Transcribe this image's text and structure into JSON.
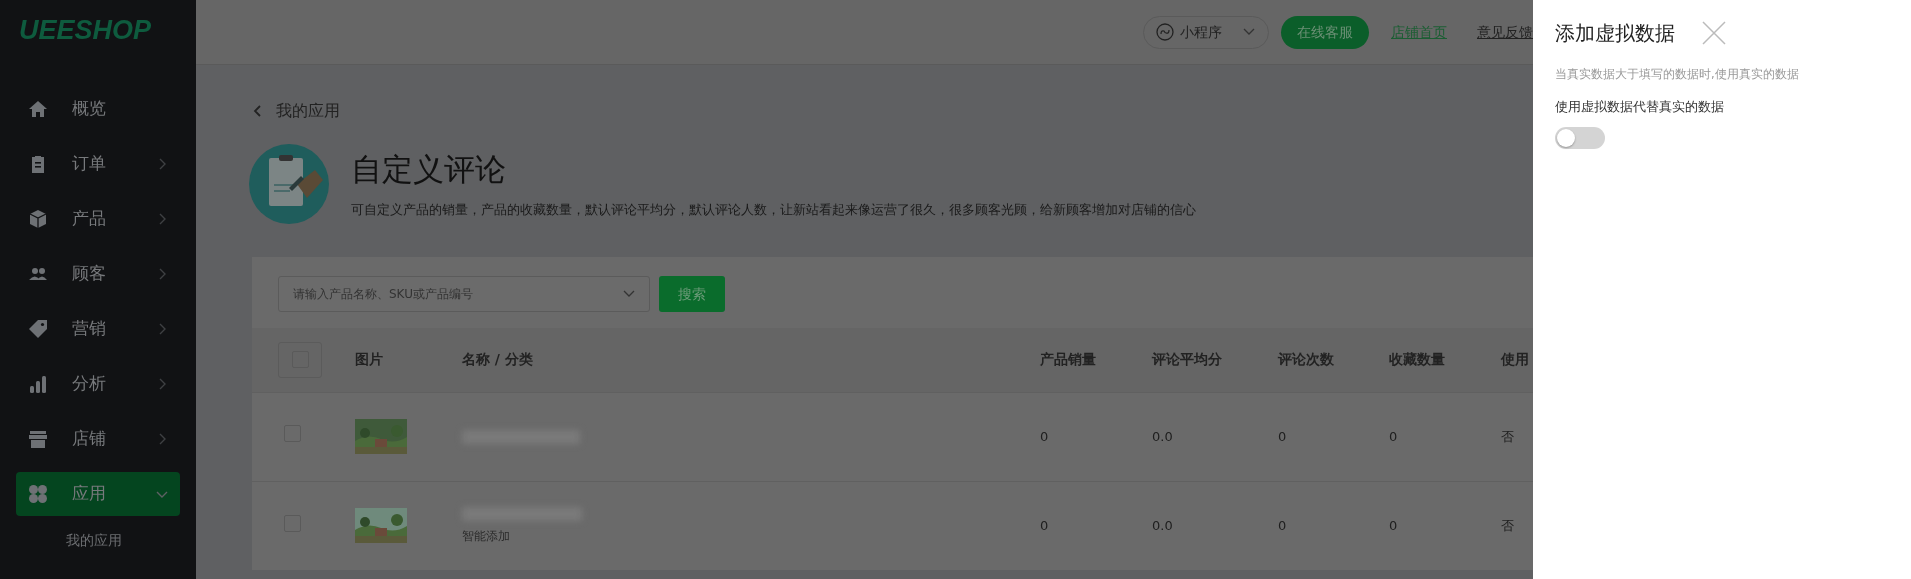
{
  "sidebar": {
    "logo": "UEESHOP",
    "items": [
      {
        "label": "概览",
        "kind": "home",
        "selected": false
      },
      {
        "label": "订单",
        "kind": "order",
        "expanded": false,
        "selected": false
      },
      {
        "label": "产品",
        "kind": "product",
        "expanded": false,
        "selected": false
      },
      {
        "label": "顾客",
        "kind": "customer",
        "expanded": false,
        "selected": false
      },
      {
        "label": "营销",
        "kind": "marketing",
        "expanded": false,
        "selected": false
      },
      {
        "label": "分析",
        "kind": "analytics",
        "expanded": false,
        "selected": false
      },
      {
        "label": "店铺",
        "kind": "store",
        "expanded": false,
        "selected": false
      },
      {
        "label": "应用",
        "kind": "apps",
        "expanded": true,
        "selected": true,
        "children": [
          {
            "label": "我的应用"
          }
        ]
      }
    ]
  },
  "top_bar": {
    "mini_program": {
      "label": "小程序"
    },
    "links": [
      {
        "label": "在线客服",
        "kind": "primary"
      },
      {
        "label": "店铺首页",
        "kind": "green-link"
      },
      {
        "label": "意见反馈",
        "kind": "link"
      }
    ]
  },
  "page": {
    "back_link": "我的应用",
    "title": "自定义评论",
    "description": "可自定义产品的销量，产品的收藏数量，默认评论平均分，默认评论人数，让新站看起来像运营了很久，很多顾客光顾，给新顾客增加对店铺的信心"
  },
  "search": {
    "placeholder": "请输入产品名称、SKU或产品编号",
    "button": "搜索"
  },
  "table": {
    "select_all_checked": false,
    "columns": [
      "图片",
      "名称 / 分类",
      "产品销量",
      "评论平均分",
      "评论次数",
      "收藏数量",
      "使用"
    ],
    "rows": [
      {
        "checked": false,
        "sales": "0",
        "rating": "0.0",
        "reviews": "0",
        "favorites": "0",
        "used": "否"
      },
      {
        "checked": false,
        "tag": "智能添加",
        "sales": "0",
        "rating": "0.0",
        "reviews": "0",
        "favorites": "0",
        "used": "否"
      }
    ]
  },
  "drawer": {
    "title": "添加虚拟数据",
    "hint": "当真实数据大于填写的数据时,使用真实的数据",
    "switch_label": "使用虚拟数据代替真实的数据",
    "switch_on": false
  }
}
